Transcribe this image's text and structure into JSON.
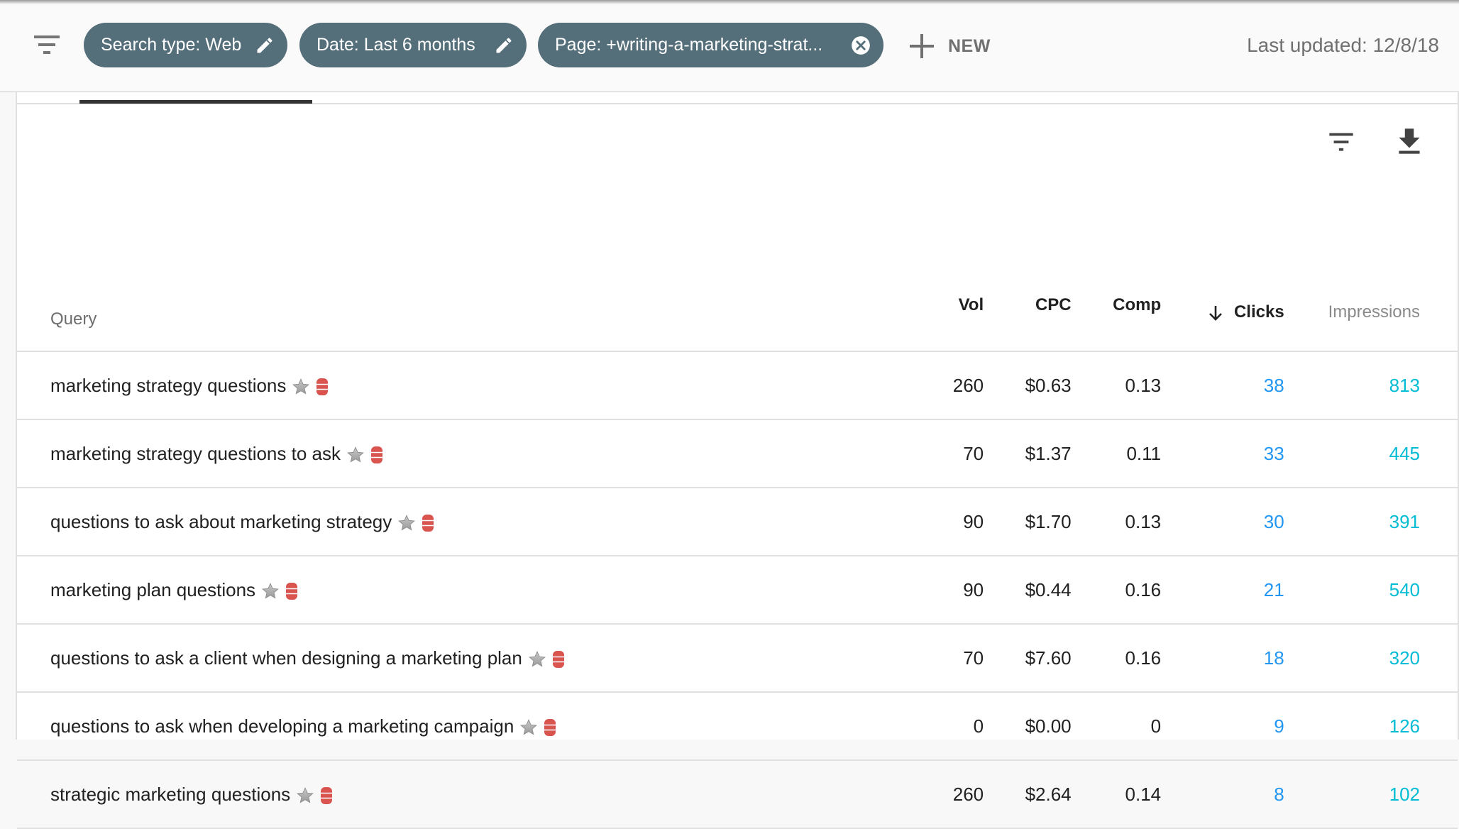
{
  "header": {
    "filter_icon": "filter-list-icon",
    "chips": [
      {
        "label": "Search type: Web",
        "icon": "pencil-icon"
      },
      {
        "label": "Date: Last 6 months",
        "icon": "pencil-icon"
      },
      {
        "label": "Page: +writing-a-marketing-strat...",
        "icon": "close-circle-icon"
      }
    ],
    "new_label": "NEW",
    "last_updated": "Last updated: 12/8/18"
  },
  "colors": {
    "chip_bg": "#546e7a",
    "clicks": "#2196f3",
    "impressions": "#00bcd4",
    "db_icon": "#d9534f"
  },
  "toolbar": {
    "filter_icon": "filter-list-icon",
    "download_icon": "download-icon"
  },
  "table": {
    "columns": {
      "query": "Query",
      "vol": "Vol",
      "cpc": "CPC",
      "comp": "Comp",
      "clicks": "Clicks",
      "impressions": "Impressions"
    },
    "sort": {
      "column": "clicks",
      "direction": "descending"
    },
    "rows": [
      {
        "query": "marketing strategy questions",
        "vol": "260",
        "cpc": "$0.63",
        "comp": "0.13",
        "clicks": "38",
        "impressions": "813"
      },
      {
        "query": "marketing strategy questions to ask",
        "vol": "70",
        "cpc": "$1.37",
        "comp": "0.11",
        "clicks": "33",
        "impressions": "445"
      },
      {
        "query": "questions to ask about marketing strategy",
        "vol": "90",
        "cpc": "$1.70",
        "comp": "0.13",
        "clicks": "30",
        "impressions": "391"
      },
      {
        "query": "marketing plan questions",
        "vol": "90",
        "cpc": "$0.44",
        "comp": "0.16",
        "clicks": "21",
        "impressions": "540"
      },
      {
        "query": "questions to ask a client when designing a marketing plan",
        "vol": "70",
        "cpc": "$7.60",
        "comp": "0.16",
        "clicks": "18",
        "impressions": "320"
      },
      {
        "query": "questions to ask when developing a marketing campaign",
        "vol": "0",
        "cpc": "$0.00",
        "comp": "0",
        "clicks": "9",
        "impressions": "126"
      },
      {
        "query": "strategic marketing questions",
        "vol": "260",
        "cpc": "$2.64",
        "comp": "0.14",
        "clicks": "8",
        "impressions": "102"
      }
    ]
  }
}
